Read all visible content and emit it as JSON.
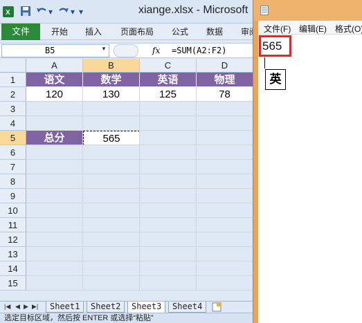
{
  "excel": {
    "window_title": "xiange.xlsx - Microsoft",
    "quick_access": [
      "▾"
    ],
    "tabs": [
      "文件",
      "开始",
      "插入",
      "页面布局",
      "公式",
      "数据",
      "审阅"
    ],
    "name_box": "B5",
    "fx_label": "fx",
    "formula": "=SUM(A2:F2)",
    "columns": [
      "A",
      "B",
      "C",
      "D"
    ],
    "rows": [
      "1",
      "2",
      "3",
      "4",
      "5",
      "6",
      "7",
      "8",
      "9",
      "10",
      "11",
      "12",
      "13",
      "14",
      "15"
    ],
    "cells": {
      "A1": "语文",
      "B1": "数学",
      "C1": "英语",
      "D1": "物理",
      "A2": "120",
      "B2": "130",
      "C2": "125",
      "D2": "78",
      "A5": "总分",
      "B5": "565"
    },
    "sheet_tabs": [
      "Sheet1",
      "Sheet2",
      "Sheet3",
      "Sheet4"
    ],
    "active_sheet": "Sheet3",
    "status_text": "选定目标区域，然后按 ENTER 或选择“粘贴”",
    "header_fill": "#8064a2"
  },
  "notepad": {
    "menu": [
      "文件(F)",
      "编辑(E)",
      "格式(O)"
    ],
    "content": "565",
    "ime_indicator": "英",
    "highlight_color": "#e2262c"
  }
}
